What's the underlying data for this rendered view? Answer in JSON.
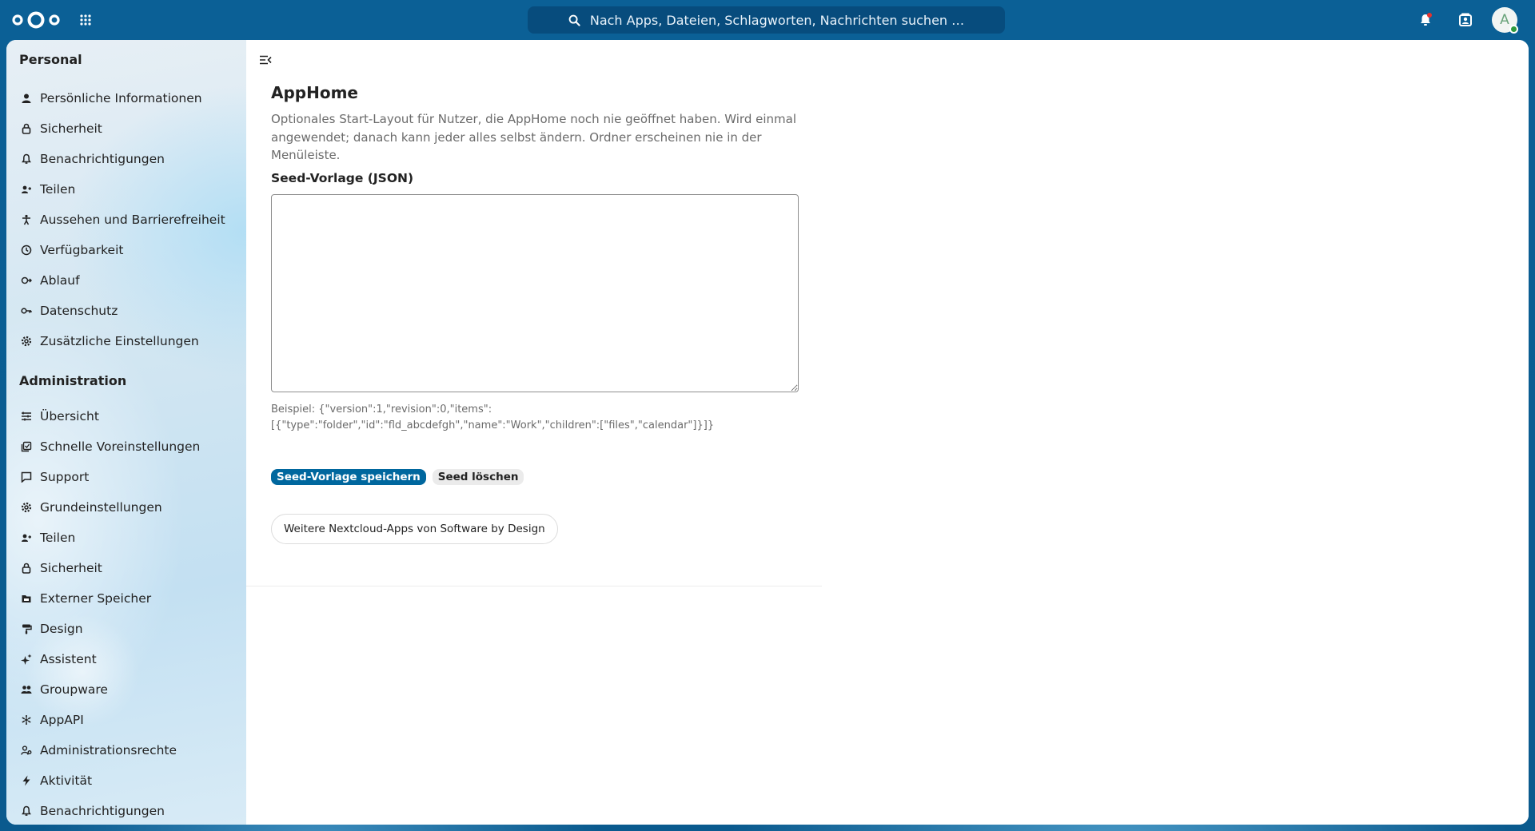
{
  "header": {
    "search_placeholder": "Nach Apps, Dateien, Schlagworten, Nachrichten suchen …",
    "avatar_initial": "A"
  },
  "sidebar": {
    "personal_heading": "Personal",
    "personal_items": [
      {
        "label": "Persönliche Informationen",
        "icon": "person-icon"
      },
      {
        "label": "Sicherheit",
        "icon": "lock-icon"
      },
      {
        "label": "Benachrichtigungen",
        "icon": "bell-icon"
      },
      {
        "label": "Teilen",
        "icon": "share-icon"
      },
      {
        "label": "Aussehen und Barrierefreiheit",
        "icon": "accessibility-icon"
      },
      {
        "label": "Verfügbarkeit",
        "icon": "clock-icon"
      },
      {
        "label": "Ablauf",
        "icon": "flow-icon"
      },
      {
        "label": "Datenschutz",
        "icon": "key-icon"
      },
      {
        "label": "Zusätzliche Einstellungen",
        "icon": "gear-icon"
      }
    ],
    "admin_heading": "Administration",
    "admin_items": [
      {
        "label": "Übersicht",
        "icon": "list-icon"
      },
      {
        "label": "Schnelle Voreinstellungen",
        "icon": "presets-icon"
      },
      {
        "label": "Support",
        "icon": "support-icon"
      },
      {
        "label": "Grundeinstellungen",
        "icon": "gear-icon"
      },
      {
        "label": "Teilen",
        "icon": "share-icon"
      },
      {
        "label": "Sicherheit",
        "icon": "lock-icon"
      },
      {
        "label": "Externer Speicher",
        "icon": "storage-icon"
      },
      {
        "label": "Design",
        "icon": "paint-icon"
      },
      {
        "label": "Assistent",
        "icon": "sparkle-icon"
      },
      {
        "label": "Groupware",
        "icon": "group-icon"
      },
      {
        "label": "AppAPI",
        "icon": "api-icon"
      },
      {
        "label": "Administrationsrechte",
        "icon": "admin-rights-icon"
      },
      {
        "label": "Aktivität",
        "icon": "bolt-icon"
      },
      {
        "label": "Benachrichtigungen",
        "icon": "bell-icon"
      }
    ]
  },
  "main": {
    "title": "AppHome",
    "description": "Optionales Start-Layout für Nutzer, die AppHome noch nie geöffnet haben. Wird einmal angewendet; danach kann jeder alles selbst ändern. Ordner erscheinen nie in der Menüleiste.",
    "seed_label": "Seed-Vorlage (JSON)",
    "seed_value": "",
    "hint_line1": "Beispiel: {\"version\":1,\"revision\":0,\"items\":",
    "hint_line2": "[{\"type\":\"folder\",\"id\":\"fld_abcdefgh\",\"name\":\"Work\",\"children\":[\"files\",\"calendar\"]}]}",
    "save_button": "Seed-Vorlage speichern",
    "clear_button": "Seed löschen",
    "more_apps_button": "Weitere Nextcloud-Apps von Software by Design"
  },
  "colors": {
    "header_bg": "#0a5e93",
    "primary": "#00679e",
    "status_online": "#2d9a3e"
  }
}
